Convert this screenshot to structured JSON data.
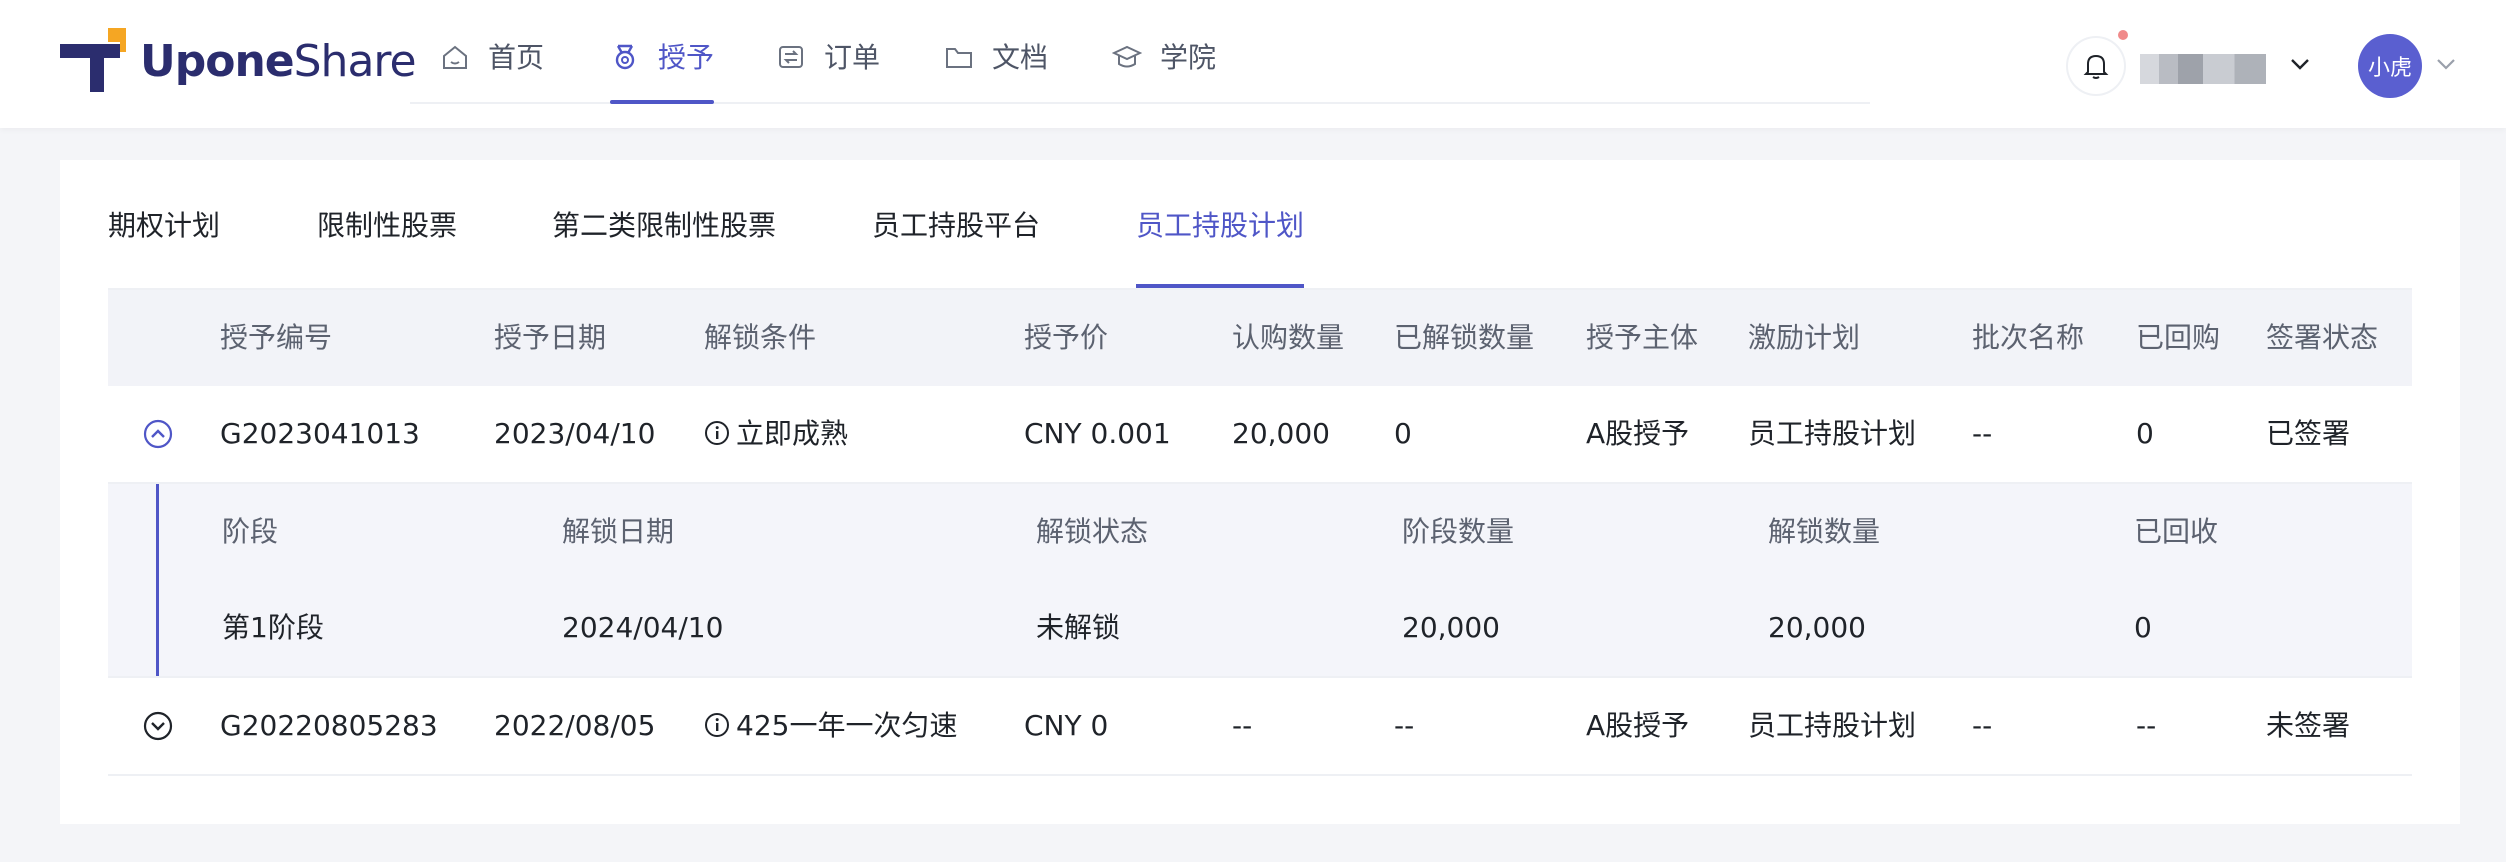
{
  "header": {
    "logo": {
      "text_part1": "Upone",
      "text_part2": "Share"
    },
    "nav": [
      {
        "label": "首页",
        "icon": "home-icon",
        "active": false
      },
      {
        "label": "授予",
        "icon": "medal-icon",
        "active": true
      },
      {
        "label": "订单",
        "icon": "order-icon",
        "active": false
      },
      {
        "label": "文档",
        "icon": "folder-icon",
        "active": false
      },
      {
        "label": "学院",
        "icon": "academy-icon",
        "active": false
      }
    ],
    "avatar_label": "小虎"
  },
  "tabs": [
    {
      "label": "期权计划",
      "active": false
    },
    {
      "label": "限制性股票",
      "active": false
    },
    {
      "label": "第二类限制性股票",
      "active": false
    },
    {
      "label": "员工持股平台",
      "active": false
    },
    {
      "label": "员工持股计划",
      "active": true
    }
  ],
  "table": {
    "columns": [
      "授予编号",
      "授予日期",
      "解锁条件",
      "授予价",
      "认购数量",
      "已解锁数量",
      "授予主体",
      "激励计划",
      "批次名称",
      "已回购",
      "签署状态"
    ],
    "rows": [
      {
        "id": "G2023041013",
        "date": "2023/04/10",
        "condition": "立即成熟",
        "price": "CNY  0.001",
        "quantity": "20,000",
        "unlocked": "0",
        "subject": "A股授予",
        "plan": "员工持股计划",
        "batch": "--",
        "repurchased": "0",
        "sign_status": "已签署",
        "expanded": true
      },
      {
        "id": "G20220805283",
        "date": "2022/08/05",
        "condition": "425一年一次匀速",
        "price": "CNY  0",
        "quantity": "--",
        "unlocked": "--",
        "subject": "A股授予",
        "plan": "员工持股计划",
        "batch": "--",
        "repurchased": "--",
        "sign_status": "未签署",
        "expanded": false
      }
    ],
    "sub_table": {
      "columns": [
        "阶段",
        "解锁日期",
        "解锁状态",
        "阶段数量",
        "解锁数量",
        "已回收"
      ],
      "row": [
        "第1阶段",
        "2024/04/10",
        "未解锁",
        "20,000",
        "20,000",
        "0"
      ]
    }
  },
  "colors": {
    "accent": "#4f56c7",
    "logo_orange": "#f5a623",
    "logo_dark": "#2b2d6e"
  }
}
